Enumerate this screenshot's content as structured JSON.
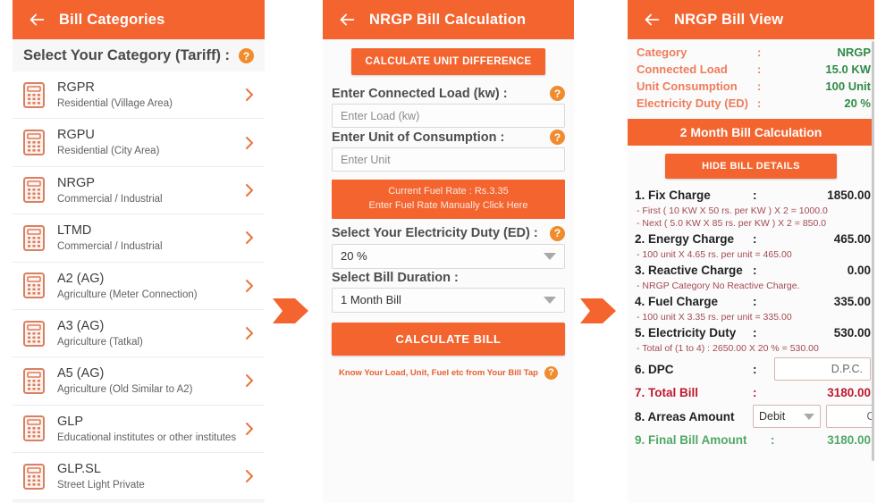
{
  "theme": {
    "accent": "#f4642f",
    "green": "#2e8b46",
    "red": "#c0182c",
    "note": "#a34a52"
  },
  "panel1": {
    "appbar": {
      "title": "Bill Categories",
      "back_icon": "arrow-left-icon"
    },
    "section_title": "Select Your Category (Tariff) :",
    "help_glyph": "?",
    "categories": [
      {
        "code": "RGPR",
        "desc": "Residential (Village Area)"
      },
      {
        "code": "RGPU",
        "desc": "Residential (City Area)"
      },
      {
        "code": "NRGP",
        "desc": "Commercial / Industrial"
      },
      {
        "code": "LTMD",
        "desc": "Commercial / Industrial"
      },
      {
        "code": "A2 (AG)",
        "desc": "Agriculture (Meter Connection)"
      },
      {
        "code": "A3 (AG)",
        "desc": "Agriculture (Tatkal)"
      },
      {
        "code": "A5 (AG)",
        "desc": "Agriculture (Old Similar to A2)"
      },
      {
        "code": "GLP",
        "desc": "Educational institutes or other institutes"
      },
      {
        "code": "GLP.SL",
        "desc": "Street Light Private"
      }
    ]
  },
  "panel2": {
    "appbar": {
      "title": "NRGP Bill Calculation",
      "back_icon": "arrow-left-icon"
    },
    "calculate_unit_difference": "CALCULATE UNIT DIFFERENCE",
    "load_label": "Enter Connected Load (kw) :",
    "load_placeholder": "Enter Load (kw)",
    "load_value": "",
    "unit_label": "Enter Unit of Consumption :",
    "unit_placeholder": "Enter Unit",
    "unit_value": "",
    "fuel_banner_line1": "Current Fuel Rate : Rs.3.35",
    "fuel_banner_line2": "Enter Fuel Rate Manually Click Here",
    "ed_label": "Select Your Electricity Duty (ED) :",
    "ed_value": "20 %",
    "duration_label": "Select Bill Duration :",
    "duration_value": "1 Month Bill",
    "calculate_bill": "CALCULATE BILL",
    "know_text": "Know Your Load, Unit, Fuel etc from Your Bill Tap",
    "help_glyph": "?"
  },
  "panel3": {
    "appbar": {
      "title": "NRGP Bill View",
      "back_icon": "arrow-left-icon"
    },
    "summary": [
      {
        "key": "Category",
        "colon": ":",
        "value": "NRGP"
      },
      {
        "key": "Connected Load",
        "colon": ":",
        "value": "15.0 KW"
      },
      {
        "key": "Unit Consumption",
        "colon": ":",
        "value": "100 Unit"
      },
      {
        "key": "Electricity Duty (ED)",
        "colon": ":",
        "value": "20 %"
      }
    ],
    "month_banner": "2 Month Bill Calculation",
    "hide_details_button": "HIDE BILL DETAILS",
    "charges": [
      {
        "name": "1. Fix Charge",
        "colon": ":",
        "amount": "1850.00",
        "notes": [
          "- First  ( 10 KW X 50 rs. per KW  ) X 2 = 1000.0",
          "- Next  ( 5.0 KW X 85 rs. per KW  ) X 2 = 850.0"
        ]
      },
      {
        "name": "2. Energy Charge",
        "colon": ":",
        "amount": "465.00",
        "notes": [
          "- 100  unit X 4.65  rs. per unit = 465.00"
        ]
      },
      {
        "name": "3. Reactive Charge",
        "colon": ":",
        "amount": "0.00",
        "notes": [
          "- NRGP Category No Reactive Charge."
        ]
      },
      {
        "name": "4. Fuel Charge",
        "colon": ":",
        "amount": "335.00",
        "notes": [
          "- 100  unit X 3.35  rs. per unit = 335.00"
        ]
      },
      {
        "name": "5. Electricity Duty",
        "colon": ":",
        "amount": "530.00",
        "notes": [
          "- Total of (1 to 4) :  2650.00 X 20 % = 530.00"
        ]
      }
    ],
    "dpc": {
      "name": "6. DPC",
      "colon": ":",
      "field_value": "D.P.C."
    },
    "total_bill": {
      "name": "7. Total Bill",
      "colon": ":",
      "amount": "3180.00"
    },
    "arrears": {
      "name": "8. Arreas Amount",
      "dropdown_value": "Debit",
      "field_value": "CR/DR"
    },
    "final_bill": {
      "name": "9. Final Bill Amount",
      "colon": ":",
      "amount": "3180.00"
    }
  },
  "flow": {
    "arrow1": "arrow-right-icon",
    "arrow2": "arrow-right-icon"
  }
}
